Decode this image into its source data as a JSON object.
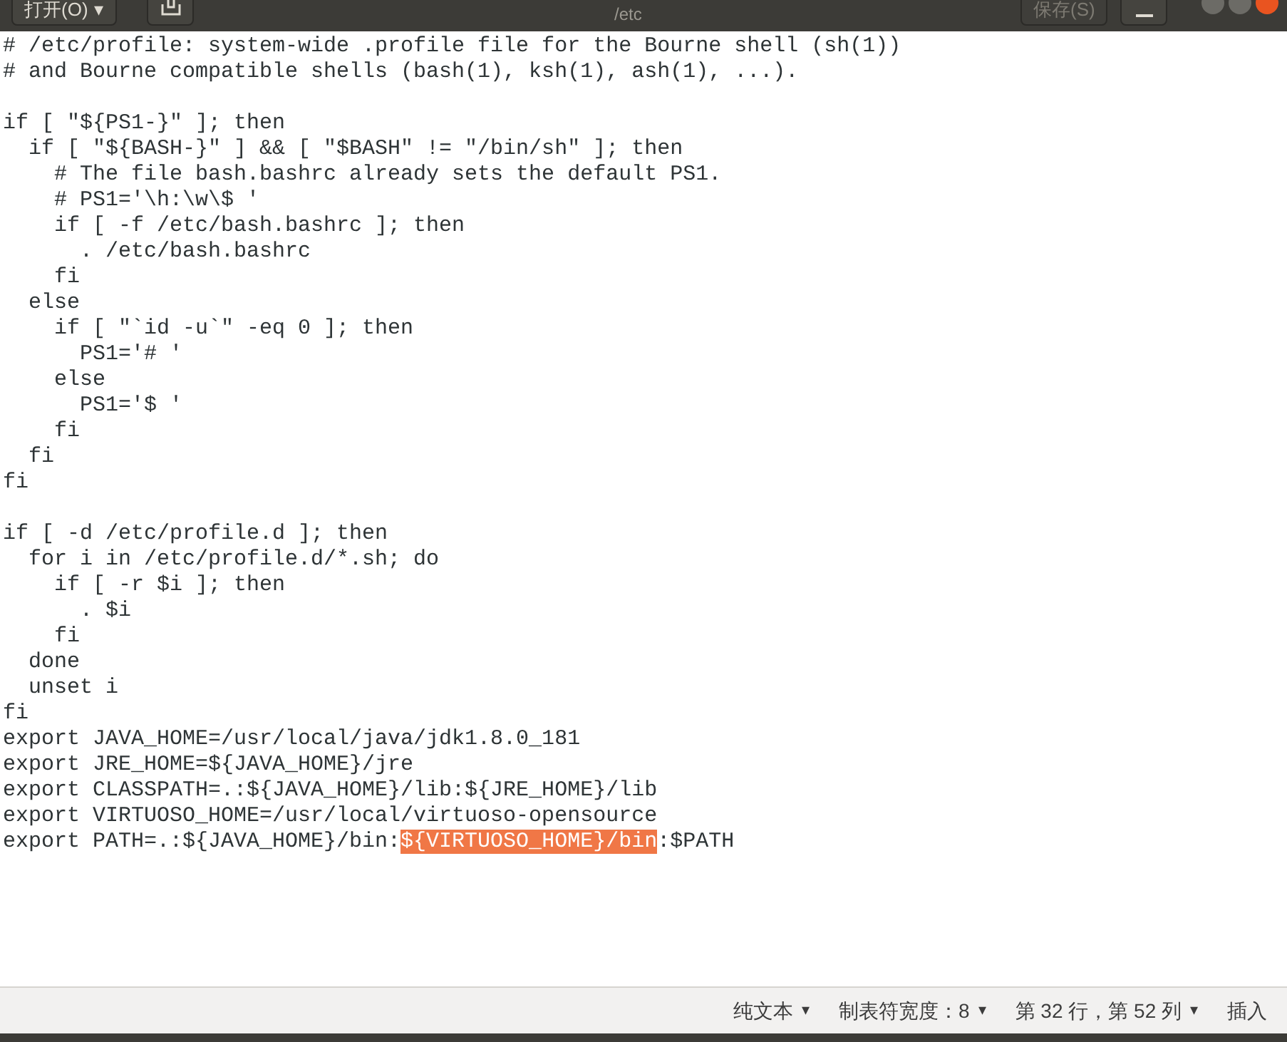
{
  "header": {
    "open_button": "打开(O)",
    "open_caret": "▾",
    "path": "/etc",
    "save_button": "保存(S)"
  },
  "lines": [
    {
      "kind": "code",
      "text": "# /etc/profile: system-wide .profile file for the Bourne shell (sh(1))"
    },
    {
      "kind": "code",
      "text": "# and Bourne compatible shells (bash(1), ksh(1), ash(1), ...)."
    },
    {
      "kind": "blank"
    },
    {
      "kind": "code",
      "text": "if [ \"${PS1-}\" ]; then"
    },
    {
      "kind": "code",
      "text": "  if [ \"${BASH-}\" ] && [ \"$BASH\" != \"/bin/sh\" ]; then"
    },
    {
      "kind": "code",
      "text": "    # The file bash.bashrc already sets the default PS1."
    },
    {
      "kind": "code",
      "text": "    # PS1='\\h:\\w\\$ '"
    },
    {
      "kind": "code",
      "text": "    if [ -f /etc/bash.bashrc ]; then"
    },
    {
      "kind": "code",
      "text": "      . /etc/bash.bashrc"
    },
    {
      "kind": "code",
      "text": "    fi"
    },
    {
      "kind": "code",
      "text": "  else"
    },
    {
      "kind": "code",
      "text": "    if [ \"`id -u`\" -eq 0 ]; then"
    },
    {
      "kind": "code",
      "text": "      PS1='# '"
    },
    {
      "kind": "code",
      "text": "    else"
    },
    {
      "kind": "code",
      "text": "      PS1='$ '"
    },
    {
      "kind": "code",
      "text": "    fi"
    },
    {
      "kind": "code",
      "text": "  fi"
    },
    {
      "kind": "code",
      "text": "fi"
    },
    {
      "kind": "blank"
    },
    {
      "kind": "code",
      "text": "if [ -d /etc/profile.d ]; then"
    },
    {
      "kind": "code",
      "text": "  for i in /etc/profile.d/*.sh; do"
    },
    {
      "kind": "code",
      "text": "    if [ -r $i ]; then"
    },
    {
      "kind": "code",
      "text": "      . $i"
    },
    {
      "kind": "code",
      "text": "    fi"
    },
    {
      "kind": "code",
      "text": "  done"
    },
    {
      "kind": "code",
      "text": "  unset i"
    },
    {
      "kind": "code",
      "text": "fi"
    },
    {
      "kind": "code",
      "text": "export JAVA_HOME=/usr/local/java/jdk1.8.0_181"
    },
    {
      "kind": "code",
      "text": "export JRE_HOME=${JAVA_HOME}/jre"
    },
    {
      "kind": "code",
      "text": "export CLASSPATH=.:${JAVA_HOME}/lib:${JRE_HOME}/lib"
    },
    {
      "kind": "code",
      "text": "export VIRTUOSO_HOME=/usr/local/virtuoso-opensource"
    },
    {
      "kind": "code",
      "segments": [
        {
          "text": "export PATH=.:${JAVA_HOME}/bin:",
          "selected": false
        },
        {
          "text": "${VIRTUOSO_HOME}/bin",
          "selected": true
        },
        {
          "text": ":$PATH",
          "selected": false
        }
      ]
    }
  ],
  "status_bar": {
    "items": [
      {
        "label": "纯文本",
        "caret": "▾"
      },
      {
        "label": "制表符宽度：8",
        "caret": "▾"
      },
      {
        "label": "第 32 行，第 52 列",
        "caret": "▾"
      },
      {
        "label": "插入"
      }
    ]
  }
}
